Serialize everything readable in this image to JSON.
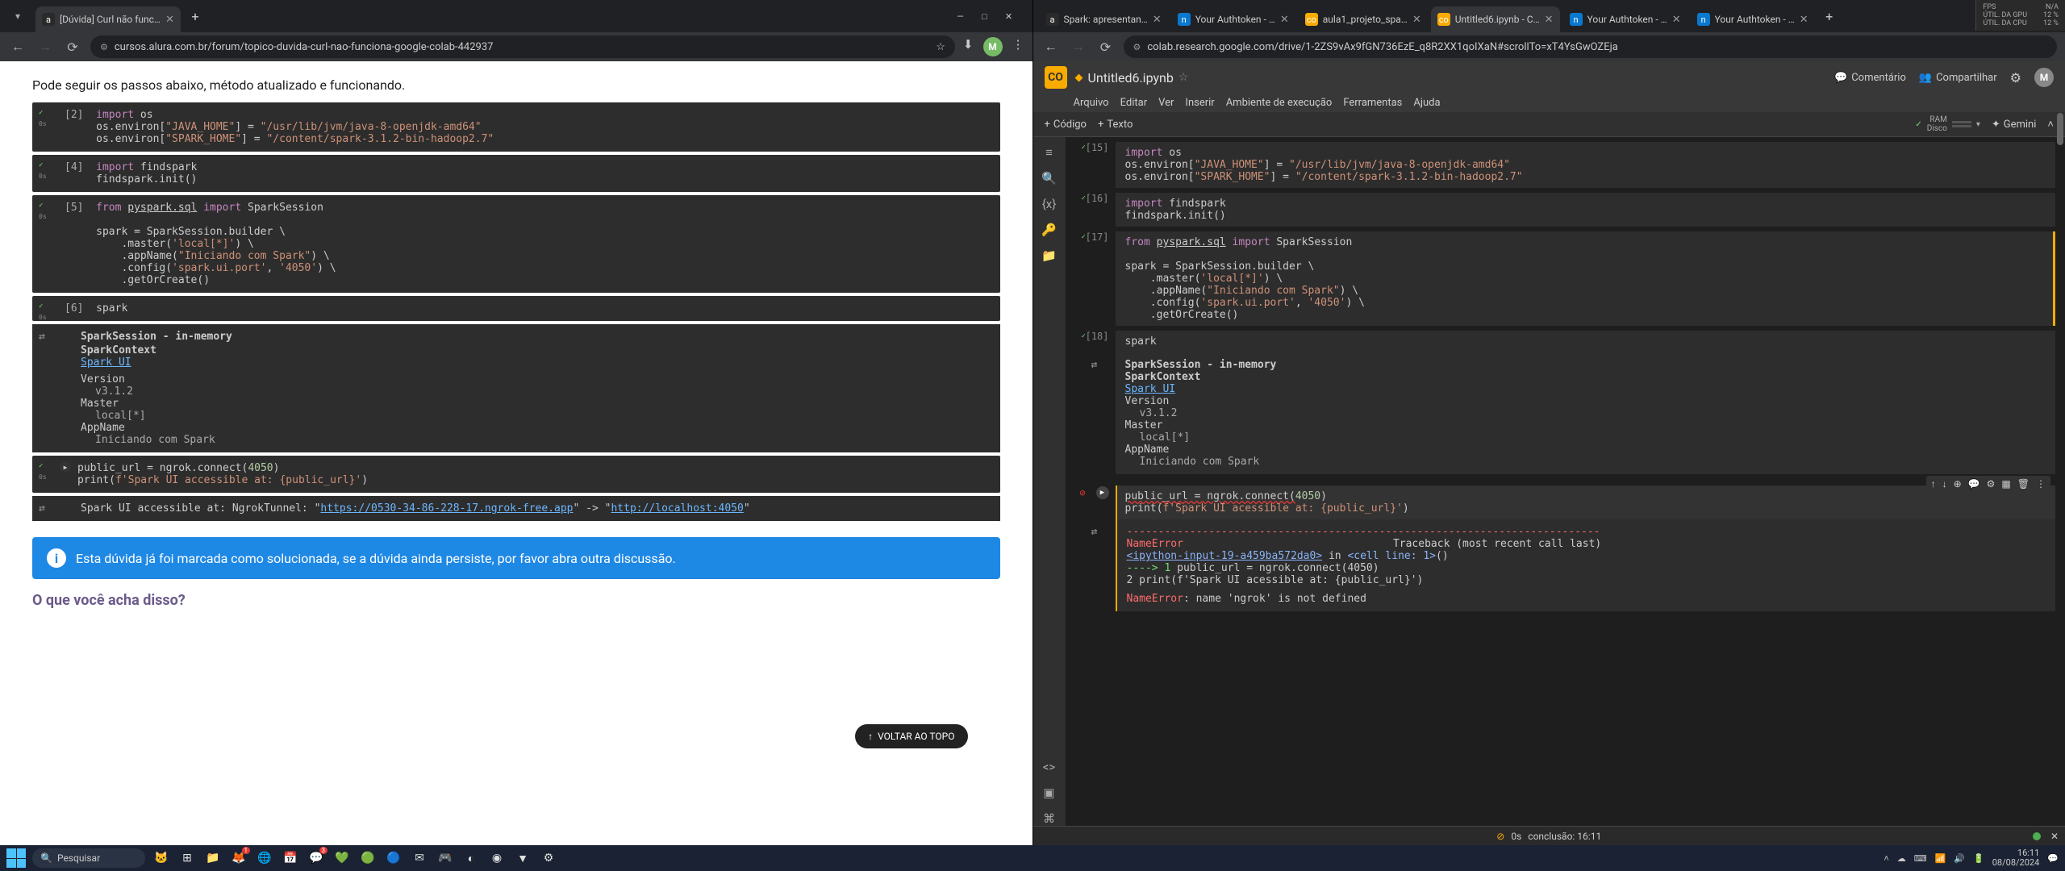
{
  "left": {
    "tab": {
      "title": "[Dúvida] Curl não funciona goo…"
    },
    "url": "cursos.alura.com.br/forum/topico-duvida-curl-nao-funciona-google-colab-442937",
    "intro": "Pode seguir os passos abaixo, método atualizado e funcionando.",
    "cells": {
      "c2": {
        "prompt": "[2]",
        "l1": "import",
        "l1b": " os",
        "l2a": "os.environ[",
        "l2b": "\"JAVA_HOME\"",
        "l2c": "] = ",
        "l2d": "\"/usr/lib/jvm/java-8-openjdk-amd64\"",
        "l3a": "os.environ[",
        "l3b": "\"SPARK_HOME\"",
        "l3c": "] = ",
        "l3d": "\"/content/spark-3.1.2-bin-hadoop2.7\""
      },
      "c4": {
        "prompt": "[4]",
        "l1": "import",
        "l1b": " findspark",
        "l2": "findspark.init()"
      },
      "c5": {
        "prompt": "[5]",
        "l1a": "from ",
        "l1b": "pyspark.sql",
        "l1c": " import",
        "l1d": " SparkSession",
        "l3": "spark = SparkSession.builder \\",
        "l4a": "    .master(",
        "l4b": "'local[*]'",
        "l4c": ") \\",
        "l5a": "    .appName(",
        "l5b": "\"Iniciando com Spark\"",
        "l5c": ") \\",
        "l6a": "    .config(",
        "l6b": "'spark.ui.port'",
        "l6c": ", ",
        "l6d": "'4050'",
        "l6e": ") \\",
        "l7": "    .getOrCreate()"
      },
      "c6": {
        "prompt": "[6]",
        "l1": "spark"
      },
      "out6": {
        "session": "SparkSession - in-memory",
        "context": "SparkContext",
        "link": "Spark UI",
        "version_k": "Version",
        "version_v": "v3.1.2",
        "master_k": "Master",
        "master_v": "local[*]",
        "app_k": "AppName",
        "app_v": "Iniciando com Spark"
      },
      "c7": {
        "l1": "public_url = ngrok.connect(",
        "l1b": "4050",
        "l1c": ")",
        "l2a": "print(",
        "l2b": "f'Spark UI accessible at: {public_url}'",
        "l2c": ")"
      },
      "out7": {
        "pre": "Spark UI accessible at: NgrokTunnel: \"",
        "link1": "https://0530-34-86-228-17.ngrok-free.app",
        "mid": "\" -> \"",
        "link2": "http://localhost:4050",
        "post": "\""
      }
    },
    "scroll_top": "VOLTAR AO TOPO",
    "banner": "Esta dúvida já foi marcada como solucionada, se a dúvida ainda persiste, por favor abra outra discussão.",
    "opinion": "O que você acha disso?",
    "avatar": "M"
  },
  "right": {
    "tabs": [
      {
        "fav": "a",
        "bg": "#2a2a2a",
        "title": "Spark: apresentan…"
      },
      {
        "fav": "n",
        "bg": "#0b78d0",
        "title": "Your Authtoken - …"
      },
      {
        "fav": "co",
        "bg": "#f9ab00",
        "title": "aula1_projeto_spa…"
      },
      {
        "fav": "co",
        "bg": "#f9ab00",
        "title": "Untitled6.ipynb - C…",
        "active": true
      },
      {
        "fav": "n",
        "bg": "#0b78d0",
        "title": "Your Authtoken - …"
      },
      {
        "fav": "n",
        "bg": "#0b78d0",
        "title": "Your Authtoken - …"
      }
    ],
    "url": "colab.research.google.com/drive/1-2ZS9vAx9fGN736EzE_q8R2XX1qoIXaN#scrollTo=xT4YsGwOZEja",
    "perf": {
      "fps_k": "FPS",
      "fps_v": "N/A",
      "gpu_k": "ÚTIL. DA GPU",
      "gpu_v": "12 %",
      "cpu_k": "ÚTIL. DA CPU",
      "cpu_v": "12 %"
    },
    "title": "Untitled6.ipynb",
    "menu": [
      "Arquivo",
      "Editar",
      "Ver",
      "Inserir",
      "Ambiente de execução",
      "Ferramentas",
      "Ajuda"
    ],
    "actions": {
      "comment": "Comentário",
      "share": "Compartilhar"
    },
    "toolbar": {
      "code": "Código",
      "text": "Texto",
      "ram": "RAM",
      "disk": "Disco",
      "gemini": "Gemini"
    },
    "cells": {
      "c15": {
        "prompt": "[15]"
      },
      "c16": {
        "prompt": "[16]"
      },
      "c17": {
        "prompt": "[17]"
      },
      "c18": {
        "prompt": "[18]",
        "l1": "spark"
      },
      "out18": {
        "session": "SparkSession - in-memory",
        "context": "SparkContext",
        "link": "Spark UI",
        "version_k": "Version",
        "version_v": "v3.1.2",
        "master_k": "Master",
        "master_v": "local[*]",
        "app_k": "AppName",
        "app_v": "Iniciando com Spark"
      },
      "c19": {
        "l1": "public_url = ngrok.connect(",
        "l1b": "4050",
        "l1c": ")",
        "l2a": "print(",
        "l2b": "f'Spark UI acessible at: {public_url}'",
        "l2c": ")"
      },
      "err": {
        "dash": "---------------------------------------------------------------------------",
        "name": "NameError",
        "trace": "Traceback (most recent call last)",
        "loc": "<ipython-input-19-a459ba572da0>",
        "inpart": " in ",
        "cellline": "<cell line: 1>",
        "rest": "()",
        "arrow": "----> 1 ",
        "l1": "public_url = ngrok.connect(4050)",
        "n2": "      2 ",
        "l2": "print(f'Spark UI acessible at: {public_url}')",
        "final_k": "NameError",
        "final_v": ": name 'ngrok' is not defined"
      }
    },
    "footer": {
      "dur": "0s",
      "concl": "conclusão: 16:11"
    }
  },
  "taskbar": {
    "search": "Pesquisar",
    "clock_time": "16:11",
    "clock_date": "08/08/2024"
  }
}
